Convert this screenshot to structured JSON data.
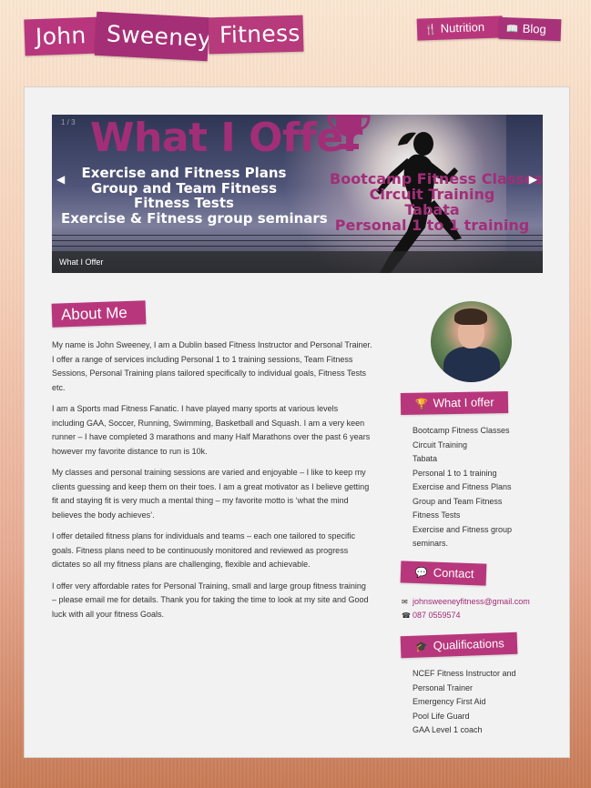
{
  "header": {
    "title_words": [
      "John",
      "Sweeney",
      "Fitness"
    ],
    "nav": [
      {
        "label": "Nutrition",
        "icon": "utensils-icon"
      },
      {
        "label": "Blog",
        "icon": "book-icon"
      }
    ]
  },
  "slider": {
    "counter": "1 / 3",
    "heading": "What I Offer",
    "left_items": [
      "Exercise and Fitness Plans",
      "Group and Team Fitness",
      "Fitness Tests",
      "Exercise & Fitness group seminars"
    ],
    "right_items": [
      "Bootcamp Fitness Classes",
      "Circuit Training",
      "Tabata",
      "Personal 1 to 1 training"
    ],
    "caption": "What I Offer"
  },
  "about": {
    "heading": "About Me",
    "paragraphs": [
      "My name is John Sweeney, I am a Dublin based Fitness Instructor and Personal Trainer. I offer a range of services including Personal 1 to 1 training sessions, Team Fitness Sessions, Personal Training plans tailored specifically to individual goals, Fitness Tests etc.",
      "I am a Sports mad Fitness Fanatic. I have played many sports at various levels including GAA, Soccer, Running, Swimming, Basketball and Squash. I am a very keen runner – I have completed 3 marathons and many Half Marathons over the past 6 years however my favorite distance to run is 10k.",
      "My classes and personal training sessions are varied and enjoyable – I like to keep my clients guessing and keep them on their toes. I am a great motivator as I believe getting fit and staying fit is very much a mental thing – my favorite motto is ‘what the mind believes the body achieves’.",
      "I offer detailed fitness plans for individuals and teams – each one tailored to specific goals. Fitness plans need to be continuously monitored and reviewed as progress dictates so all my fitness plans are challenging, flexible and achievable.",
      "I offer very affordable rates for Personal Training, small and large group fitness training – please email me for details. Thank you for taking the time to look at my site and Good luck with all your fitness Goals."
    ]
  },
  "sidebar": {
    "offer_heading": "What I offer",
    "offer_items": [
      "Bootcamp Fitness Classes",
      "Circuit Training",
      "Tabata",
      "Personal 1 to 1 training",
      "Exercise and Fitness Plans",
      "Group and Team Fitness",
      "Fitness Tests",
      "Exercise and Fitness group",
      "seminars."
    ],
    "contact_heading": "Contact",
    "email": "johnsweeneyfitness@gmail.com",
    "phone": "087 0559574",
    "qual_heading": "Qualifications",
    "qual_items": [
      "NCEF Fitness Instructor and",
      "Personal Trainer",
      "Emergency First Aid",
      "Pool Life Guard",
      "GAA Level 1 coach"
    ]
  },
  "colors": {
    "accent": "#b8377c",
    "link": "#a12a74",
    "panel": "#f2f2f2"
  }
}
